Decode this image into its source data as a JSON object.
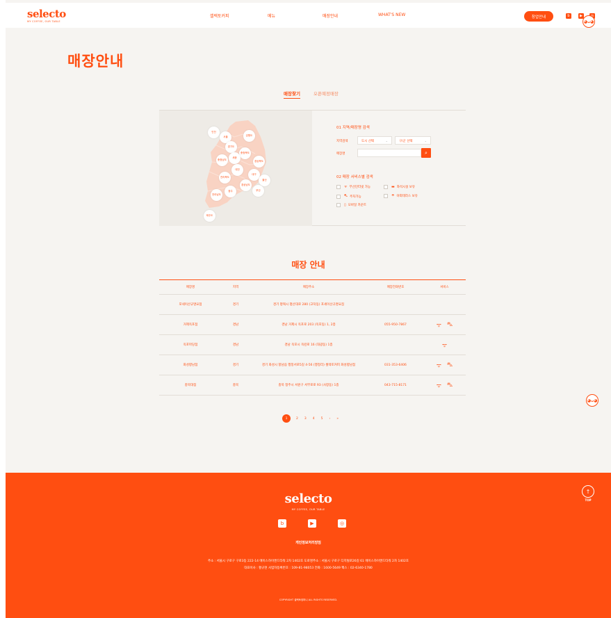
{
  "header": {
    "logo": "selecto",
    "logo_sub": "MY COFFEE, OUR TABLE",
    "nav": [
      "셀렉토커피",
      "메뉴",
      "매장안내",
      "WHAT'S NEW"
    ],
    "join_button": "창업안내"
  },
  "page": {
    "title": "매장안내",
    "tabs": [
      "매장찾기",
      "오픈예정매장"
    ]
  },
  "map": {
    "pins": [
      "인천",
      "서울",
      "강원도",
      "경기도",
      "충청북도",
      "세종",
      "충청남도",
      "경상북도",
      "대전",
      "대구",
      "울산",
      "전라북도",
      "경상남도",
      "부산",
      "광주",
      "전라남도",
      "제주도"
    ]
  },
  "search": {
    "region_title": "01 지역/매장명 검색",
    "region_label": "지역검색",
    "city_select": "도시 선택",
    "district_select": "구/군 선택",
    "store_label": "매장명",
    "store_placeholder": "",
    "service_title": "02 매장 서비스별 검색",
    "services": [
      {
        "icon": "wifi-icon",
        "glyph": "ᯤ",
        "label": "무선인터넷 가능"
      },
      {
        "icon": "sofa-icon",
        "glyph": "▬",
        "label": "좌석시설 보유"
      },
      {
        "icon": "car-icon",
        "glyph": "⛍",
        "label": "주차가능"
      },
      {
        "icon": "umbrella-icon",
        "glyph": "☂",
        "label": "야외테라스 보유"
      },
      {
        "icon": "phone-icon",
        "glyph": "▯",
        "label": "모바일 카운트"
      }
    ]
  },
  "store_list": {
    "title": "매장 안내",
    "headers": [
      "매장명",
      "지역",
      "매장주소",
      "매장전화번호",
      "서비스"
    ],
    "rows": [
      {
        "name": "포세이산규명요점",
        "region": "경기",
        "address": "경기 평택시 평산대로 280 (고덕동) 포세이산규명요점",
        "phone": "",
        "services": []
      },
      {
        "name": "거제옥포점",
        "region": "경남",
        "address": "경남 거제시 옥포로 203 (옥포동) 1, 2층",
        "phone": "055-950-7867",
        "services": [
          "wifi",
          "car"
        ]
      },
      {
        "name": "옥포마당점",
        "region": "경남",
        "address": "경남 옥포시 옥련로 16 (대광동) 1층",
        "phone": "",
        "services": [
          "wifi"
        ]
      },
      {
        "name": "화성향남점",
        "region": "경기",
        "address": "경기 화성시 향남읍 행정서로5길 4-56 (행정리) 셀렉토커피 화성향남점",
        "phone": "031-353-6406",
        "services": [
          "wifi",
          "car"
        ]
      },
      {
        "name": "충북대점",
        "region": "충북",
        "address": "충북 청주시 서원구 서부로로 93 (사창동) 1층",
        "phone": "043-715-8171",
        "services": [
          "wifi",
          "car"
        ]
      }
    ]
  },
  "pagination": {
    "pages": [
      "1",
      "2",
      "3",
      "4",
      "5"
    ],
    "next": "›",
    "last": "»"
  },
  "footer": {
    "logo": "selecto",
    "logo_sub": "MY COFFEE, OUR TABLE",
    "policy": "개인정보처리방침",
    "info_line1": "주소 : 서울시 구로구 구로3동 222-14 에이스하이엔드타워 2차 1402호  도로명주소 : 서울시 구로구 디지털로26길 61 에이스하이엔드타워 2차 1402호",
    "info_line2": "대표이사 : 황규현  사업자등록번호 : 109-81-98053  전화 : 1600-5649  팩스 : 02-6340-1780",
    "copyright": "COPYRIGHT 셀렉토컴퍼니 ALL RIGHTS RESERVED.",
    "top_label": "TOP"
  },
  "colors": {
    "brand": "#ff4e11",
    "background": "#f6f4f1"
  }
}
